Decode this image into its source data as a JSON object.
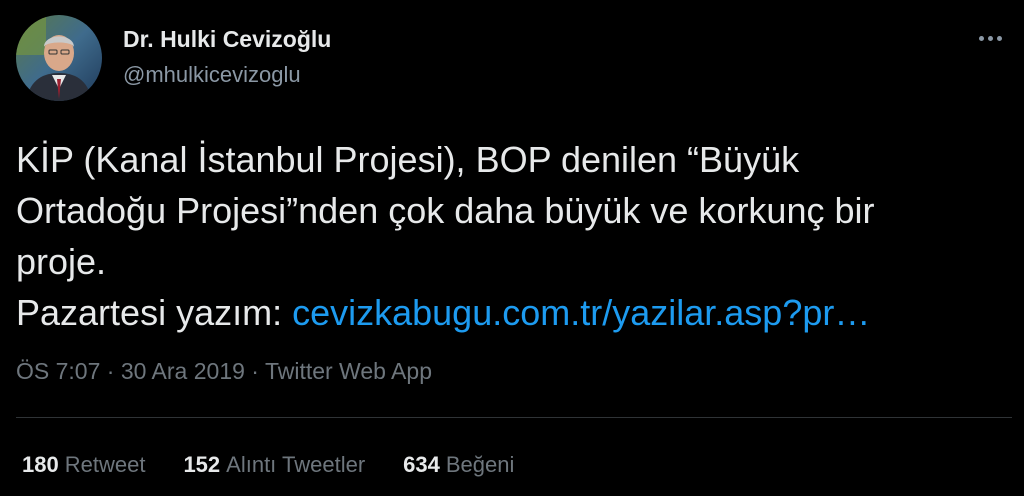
{
  "author": {
    "name": "Dr. Hulki Cevizoğlu",
    "handle": "@mhulkicevizoglu"
  },
  "tweet": {
    "line1": "KİP (Kanal İstanbul Projesi), BOP denilen “Büyük",
    "line2": "Ortadoğu Projesi”nden çok daha büyük ve korkunç bir",
    "line3": "proje.",
    "line4_prefix": "Pazartesi yazım: ",
    "link": "cevizkabugu.com.tr/yazilar.asp?pr…"
  },
  "meta": {
    "time": "ÖS 7:07",
    "date": "30 Ara 2019",
    "source": "Twitter Web App"
  },
  "stats": {
    "retweets": "180",
    "retweets_label": "Retweet",
    "quotes": "152",
    "quotes_label": "Alıntı Tweetler",
    "likes": "634",
    "likes_label": "Beğeni"
  },
  "colors": {
    "background": "#000000",
    "link": "#1d9bf0",
    "secondary_text": "#6e767d"
  },
  "icons": {
    "more": "more-horizontal-icon"
  }
}
